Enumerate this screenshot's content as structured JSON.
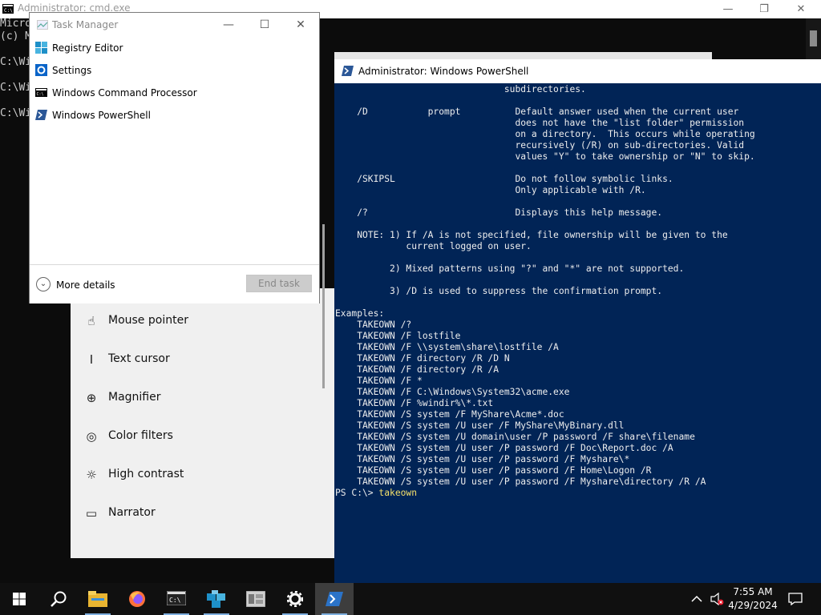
{
  "cmd": {
    "title": "Administrator: cmd.exe",
    "lines": [
      "Micro",
      "(c) M",
      "",
      "C:\\Wi",
      "",
      "C:\\Wi",
      "",
      "C:\\Wi"
    ],
    "minimize": "—",
    "restore": "❐",
    "close": "✕"
  },
  "task_manager": {
    "title": "Task Manager",
    "minimize": "—",
    "maximize": "☐",
    "close": "✕",
    "items": [
      {
        "label": "Registry Editor",
        "icon": "registry-editor-icon"
      },
      {
        "label": "Settings",
        "icon": "settings-icon"
      },
      {
        "label": "Windows Command Processor",
        "icon": "cmd-icon"
      },
      {
        "label": "Windows PowerShell",
        "icon": "powershell-icon"
      }
    ],
    "more_details": "More details",
    "end_task": "End task"
  },
  "settings": {
    "items": [
      {
        "label": "Mouse pointer",
        "icon": "mouse-pointer-icon"
      },
      {
        "label": "Text cursor",
        "icon": "text-cursor-icon"
      },
      {
        "label": "Magnifier",
        "icon": "magnifier-icon"
      },
      {
        "label": "Color filters",
        "icon": "color-filters-icon"
      },
      {
        "label": "High contrast",
        "icon": "high-contrast-icon"
      },
      {
        "label": "Narrator",
        "icon": "narrator-icon"
      }
    ]
  },
  "powershell": {
    "title": "Administrator: Windows PowerShell",
    "lines": [
      "                               subdirectories.",
      "",
      "    /D           prompt          Default answer used when the current user",
      "                                 does not have the \"list folder\" permission",
      "                                 on a directory.  This occurs while operating",
      "                                 recursively (/R) on sub-directories. Valid",
      "                                 values \"Y\" to take ownership or \"N\" to skip.",
      "",
      "    /SKIPSL                      Do not follow symbolic links.",
      "                                 Only applicable with /R.",
      "",
      "    /?                           Displays this help message.",
      "",
      "    NOTE: 1) If /A is not specified, file ownership will be given to the",
      "             current logged on user.",
      "",
      "          2) Mixed patterns using \"?\" and \"*\" are not supported.",
      "",
      "          3) /D is used to suppress the confirmation prompt.",
      "",
      "Examples:",
      "    TAKEOWN /?",
      "    TAKEOWN /F lostfile",
      "    TAKEOWN /F \\\\system\\share\\lostfile /A",
      "    TAKEOWN /F directory /R /D N",
      "    TAKEOWN /F directory /R /A",
      "    TAKEOWN /F *",
      "    TAKEOWN /F C:\\Windows\\System32\\acme.exe",
      "    TAKEOWN /F %windir%\\*.txt",
      "    TAKEOWN /S system /F MyShare\\Acme*.doc",
      "    TAKEOWN /S system /U user /F MyShare\\MyBinary.dll",
      "    TAKEOWN /S system /U domain\\user /P password /F share\\filename",
      "    TAKEOWN /S system /U user /P password /F Doc\\Report.doc /A",
      "    TAKEOWN /S system /U user /P password /F Myshare\\*",
      "    TAKEOWN /S system /U user /P password /F Home\\Logon /R",
      "    TAKEOWN /S system /U user /P password /F Myshare\\directory /R /A"
    ],
    "prompt": "PS C:\\> ",
    "command": "takeown"
  },
  "taskbar": {
    "items": [
      "start-icon",
      "search-icon",
      "file-explorer-icon",
      "firefox-icon",
      "cmd-icon",
      "registry-editor-icon",
      "server-manager-icon",
      "settings-icon",
      "powershell-icon"
    ],
    "time": "7:55 AM",
    "date": "4/29/2024"
  },
  "colors": {
    "ps_bg": "#012456",
    "prompt_cmd": "#f5e06b",
    "taskbar": "#101010"
  }
}
